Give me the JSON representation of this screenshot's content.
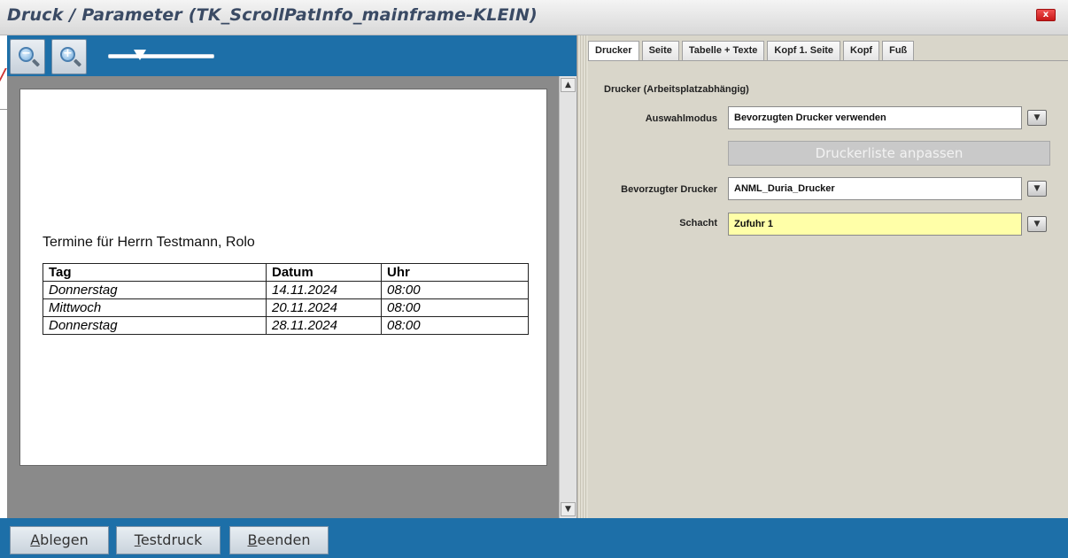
{
  "window": {
    "title": "Druck / Parameter  (TK_ScrollPatInfo_mainframe-KLEIN)",
    "close_label": "x"
  },
  "toolbar": {
    "zoom_out_icon": "zoom-out-icon",
    "zoom_in_icon": "zoom-in-icon",
    "zoom_level": 0.3
  },
  "preview": {
    "heading": "Termine für Herrn  Testmann, Rolo",
    "columns": [
      "Tag",
      "Datum",
      "Uhr"
    ],
    "rows": [
      [
        "Donnerstag",
        "14.11.2024",
        "08:00"
      ],
      [
        "Mittwoch",
        "20.11.2024",
        "08:00"
      ],
      [
        "Donnerstag",
        "28.11.2024",
        "08:00"
      ]
    ]
  },
  "tabs": [
    "Drucker",
    "Seite",
    "Tabelle + Texte",
    "Kopf 1. Seite",
    "Kopf",
    "Fuß"
  ],
  "active_tab": "Drucker",
  "printer": {
    "group_title": "Drucker (Arbeitsplatzabhängig)",
    "mode_label": "Auswahlmodus",
    "mode_value": "Bevorzugten Drucker verwenden",
    "adjust_button": "Druckerliste anpassen",
    "preferred_label": "Bevorzugter Drucker",
    "preferred_value": "ANML_Duria_Drucker",
    "tray_label": "Schacht",
    "tray_value": "Zufuhr 1"
  },
  "bottom": {
    "save_first": "A",
    "save_rest": "blegen",
    "test_first": "T",
    "test_rest": "estdruck",
    "exit_first": "B",
    "exit_rest": "eenden"
  },
  "colors": {
    "accent_blue": "#1d6fa8",
    "panel_beige": "#d9d6ca",
    "highlight_yellow": "#ffffa8"
  }
}
